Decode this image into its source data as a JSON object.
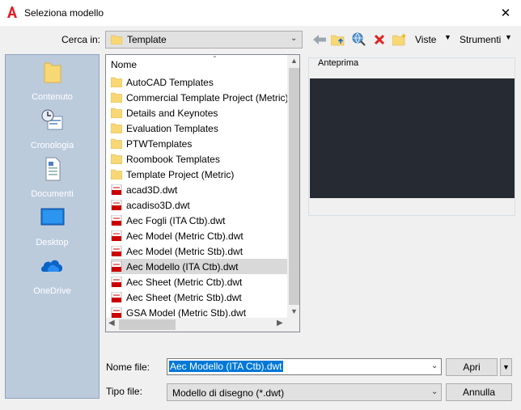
{
  "window": {
    "title": "Seleziona modello",
    "close": "✕"
  },
  "toolbar": {
    "look_in_label": "Cerca in:",
    "look_in_value": "Template",
    "views_label": "Viste",
    "tools_label": "Strumenti"
  },
  "places": [
    {
      "label": "Contenuto",
      "icon": "folder-icon"
    },
    {
      "label": "Cronologia",
      "icon": "history-icon"
    },
    {
      "label": "Documenti",
      "icon": "documents-icon"
    },
    {
      "label": "Desktop",
      "icon": "desktop-icon"
    },
    {
      "label": "OneDrive",
      "icon": "onedrive-icon"
    }
  ],
  "file_list": {
    "column_name": "Nome",
    "items": [
      {
        "name": "AutoCAD Templates",
        "type": "folder"
      },
      {
        "name": "Commercial Template Project (Metric)",
        "type": "folder"
      },
      {
        "name": "Details and Keynotes",
        "type": "folder"
      },
      {
        "name": "Evaluation Templates",
        "type": "folder"
      },
      {
        "name": "PTWTemplates",
        "type": "folder"
      },
      {
        "name": "Roombook Templates",
        "type": "folder"
      },
      {
        "name": "Template Project (Metric)",
        "type": "folder"
      },
      {
        "name": "acad3D.dwt",
        "type": "dwt"
      },
      {
        "name": "acadiso3D.dwt",
        "type": "dwt"
      },
      {
        "name": "Aec Fogli (ITA Ctb).dwt",
        "type": "dwt"
      },
      {
        "name": "Aec Model (Metric Ctb).dwt",
        "type": "dwt"
      },
      {
        "name": "Aec Model (Metric Stb).dwt",
        "type": "dwt"
      },
      {
        "name": "Aec Modello (ITA Ctb).dwt",
        "type": "dwt",
        "selected": true
      },
      {
        "name": "Aec Sheet (Metric Ctb).dwt",
        "type": "dwt"
      },
      {
        "name": "Aec Sheet (Metric Stb).dwt",
        "type": "dwt"
      },
      {
        "name": "GSA Model (Metric Stb).dwt",
        "type": "dwt"
      }
    ]
  },
  "preview": {
    "label": "Anteprima",
    "background": "#262b33"
  },
  "bottom": {
    "file_name_label": "Nome file:",
    "file_name_value": "Aec Modello (ITA Ctb).dwt",
    "file_type_label": "Tipo file:",
    "file_type_value": "Modello di disegno (*.dwt)",
    "open_label": "Apri",
    "cancel_label": "Annulla"
  },
  "colors": {
    "accent": "#0078d7",
    "places_bg": "#bccbdc",
    "folder": "#f8d775"
  }
}
